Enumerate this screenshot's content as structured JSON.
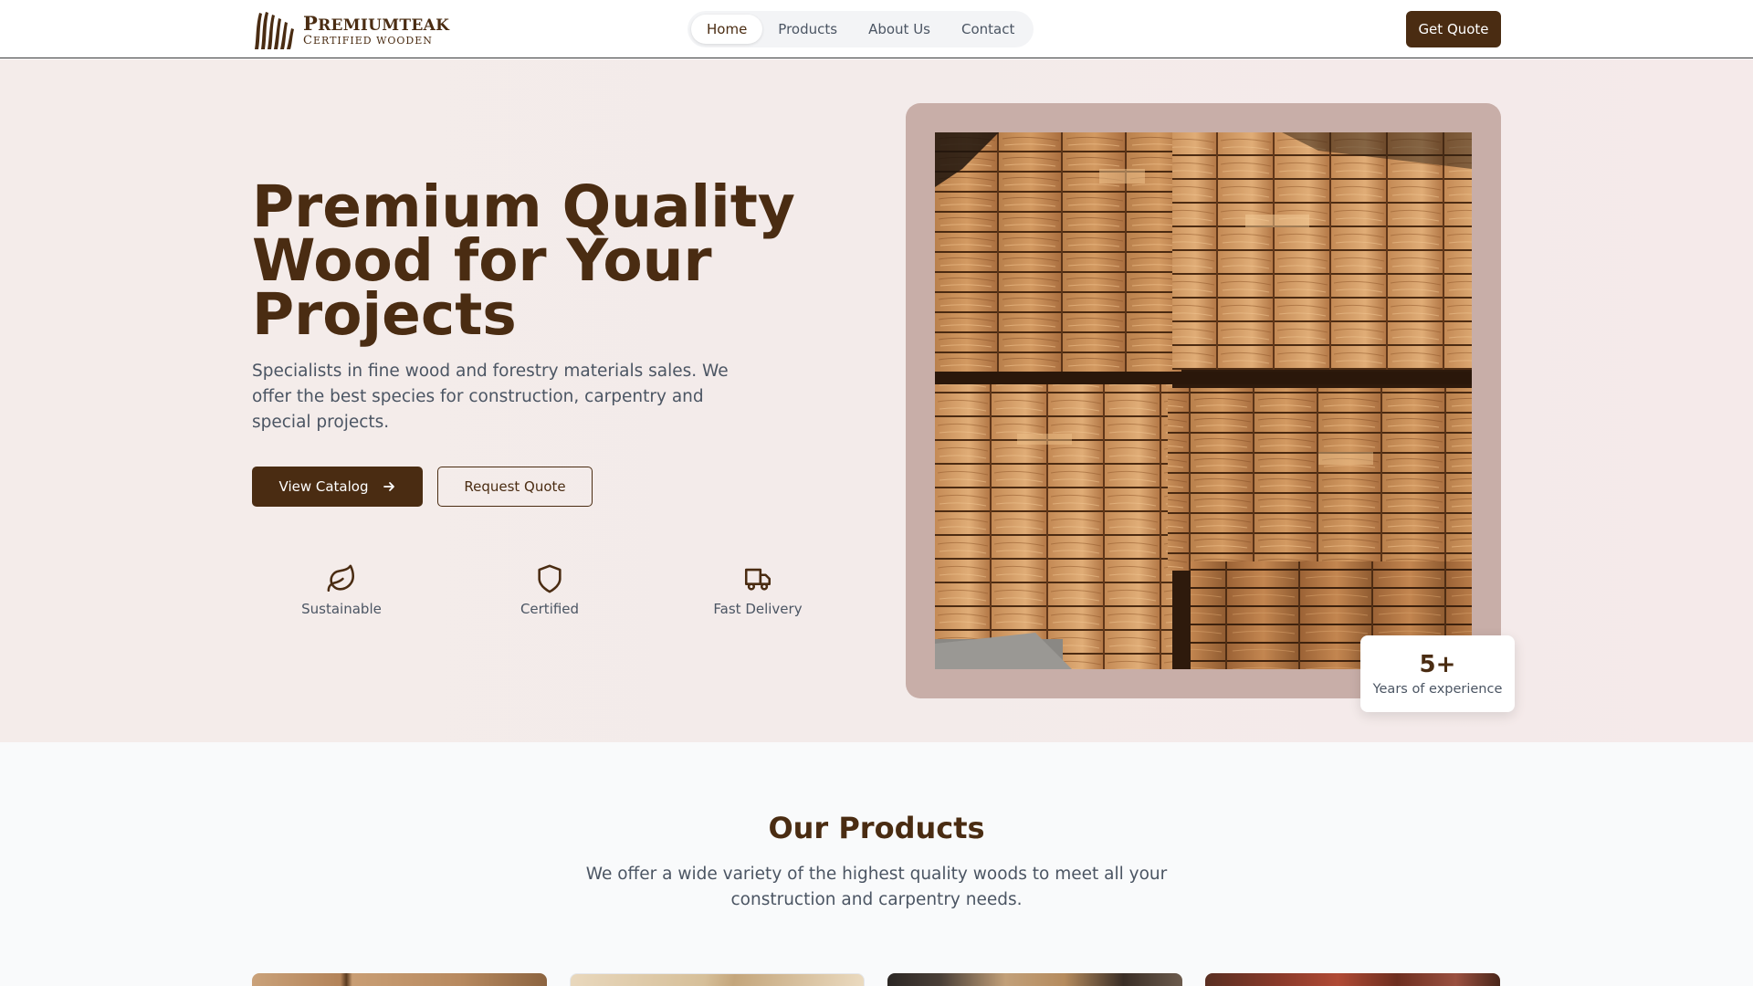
{
  "header": {
    "logo": {
      "name_big": "P",
      "name_rest": "REMIUMTEAK",
      "sub_big": "C",
      "sub_rest": "ERTIFIED WOODEN"
    },
    "nav": [
      {
        "label": "Home",
        "active": true
      },
      {
        "label": "Products",
        "active": false
      },
      {
        "label": "About Us",
        "active": false
      },
      {
        "label": "Contact",
        "active": false
      }
    ],
    "cta_label": "Get Quote"
  },
  "hero": {
    "title": "Premium Quality Wood for Your Projects",
    "description": "Specialists in fine wood and forestry materials sales. We offer the best species for construction, carpentry and special projects.",
    "primary_button": "View Catalog",
    "secondary_button": "Request Quote",
    "features": [
      {
        "icon": "leaf-icon",
        "label": "Sustainable"
      },
      {
        "icon": "shield-icon",
        "label": "Certified"
      },
      {
        "icon": "truck-icon",
        "label": "Fast Delivery"
      }
    ],
    "experience": {
      "value": "5+",
      "label": "Years of experience"
    }
  },
  "products": {
    "title": "Our Products",
    "description": "We offer a wide variety of the highest quality woods to meet all your construction and carpentry needs."
  },
  "colors": {
    "brand": "#4a2c12",
    "hero_bg": "#f4ecea",
    "frame": "#c8aea8",
    "text": "#4b5563"
  }
}
